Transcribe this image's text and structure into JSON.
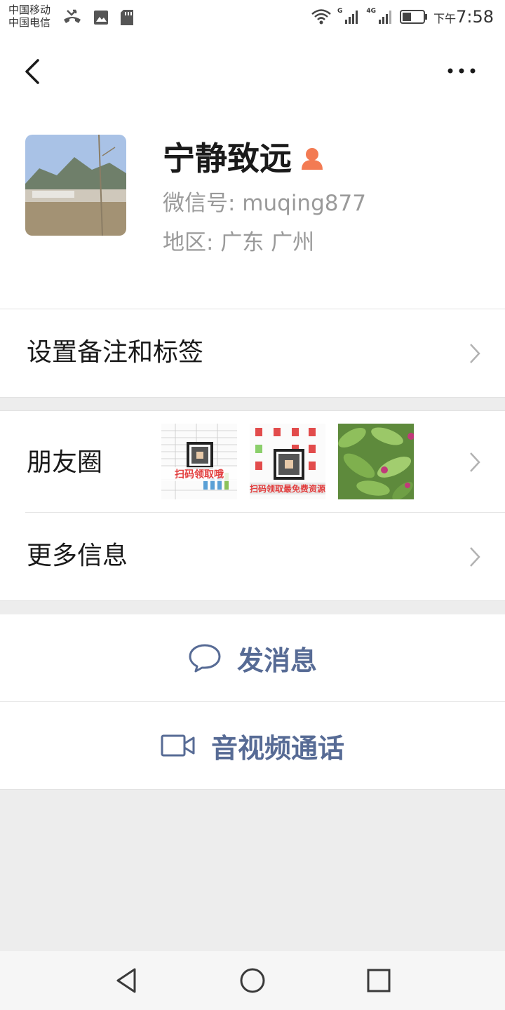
{
  "status_bar": {
    "carrier_1": "中国移动",
    "carrier_2": "中国电信",
    "left_icons": [
      "missed-call-icon",
      "image-icon",
      "sd-card-icon"
    ],
    "network_1": "G",
    "network_2": "4G",
    "time_prefix": "下午",
    "time": "7:58"
  },
  "header": {
    "nickname": "宁静致远",
    "gender_icon": "female-user-icon",
    "gender_color": "#f37b53",
    "wechat_id": "微信号: muqing877",
    "region": "地区: 广东  广州"
  },
  "menu": {
    "remark_label": "设置备注和标签",
    "moments_label": "朋友圈",
    "moments_thumbs": [
      {
        "caption": "扫码领取哦"
      },
      {
        "caption": "扫码领取最免费资源"
      },
      {
        "caption": ""
      }
    ],
    "more_info_label": "更多信息"
  },
  "actions": {
    "message_label": "发消息",
    "message_icon": "chat-bubble-icon",
    "video_label": "音视频通话",
    "video_icon": "video-camera-icon",
    "link_color": "#576b95"
  },
  "nav_bar": {
    "icons": [
      "back-triangle-icon",
      "home-circle-icon",
      "recents-square-icon"
    ]
  }
}
